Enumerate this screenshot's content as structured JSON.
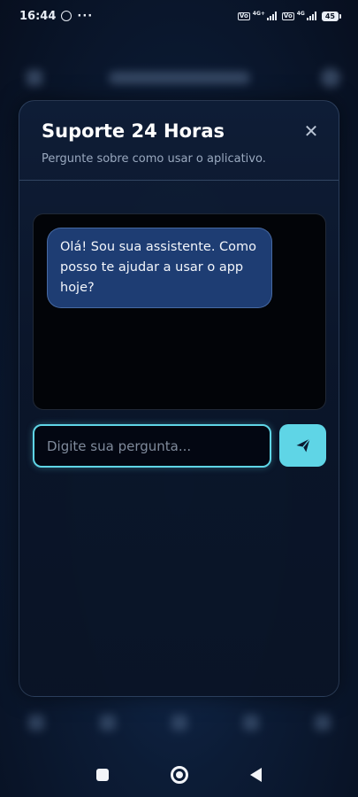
{
  "status_bar": {
    "time": "16:44",
    "dots": "···",
    "net1_label": "VoLTE",
    "net1_type": "4G+",
    "net2_label": "VoLTE",
    "net2_type": "4G",
    "battery": "45"
  },
  "modal": {
    "title": "Suporte 24 Horas",
    "subtitle": "Pergunte sobre como usar o aplicativo.",
    "close_icon": "✕"
  },
  "chat": {
    "messages": [
      {
        "sender": "assistant",
        "text": "Olá! Sou sua assistente. Como posso te ajudar a usar o app hoje?"
      }
    ]
  },
  "input": {
    "placeholder": "Digite sua pergunta...",
    "value": ""
  },
  "colors": {
    "accent": "#5fd5e6",
    "bubble": "#1e3d73",
    "background": "#0c1c36"
  },
  "icons": {
    "send": "send-icon",
    "close": "close-icon",
    "whatsapp": "whatsapp-icon"
  }
}
